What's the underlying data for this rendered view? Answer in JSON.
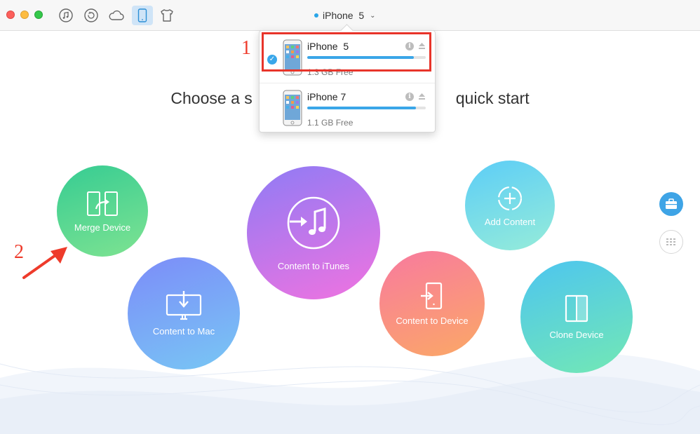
{
  "window": {
    "current_device": "iPhone  5",
    "toolbar": [
      "itunes-library",
      "backup",
      "icloud",
      "device",
      "clothes"
    ]
  },
  "heading": {
    "left": "Choose a s",
    "right": "quick start"
  },
  "dropdown": {
    "devices": [
      {
        "name": "iPhone  5",
        "free": "1.3 GB Free",
        "selected": true,
        "used_fraction": 0.9
      },
      {
        "name": "iPhone 7",
        "free": "1.1 GB Free",
        "selected": false,
        "used_fraction": 0.92
      }
    ]
  },
  "circles": {
    "merge": "Merge Device",
    "mac": "Content to Mac",
    "itunes": "Content to iTunes",
    "device": "Content to Device",
    "add": "Add Content",
    "clone": "Clone Device"
  },
  "annotations": {
    "one": "1",
    "two": "2"
  },
  "colors": {
    "accent": "#39a7ea",
    "highlight": "#e8342a",
    "annotation": "#ee3b2b"
  }
}
